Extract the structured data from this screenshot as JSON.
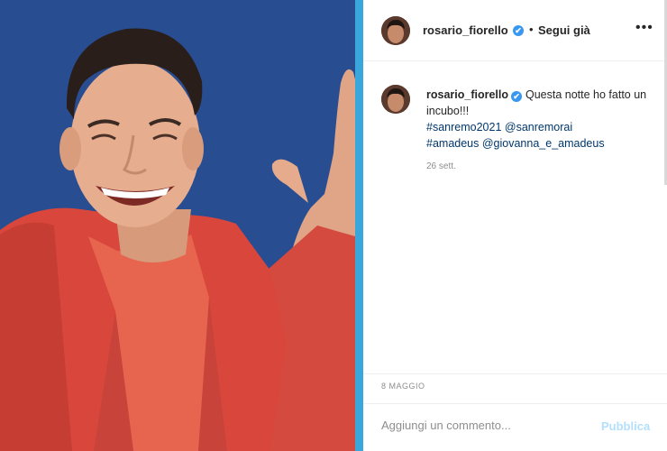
{
  "post": {
    "username": "rosario_fiorello",
    "follow_status": "Segui già",
    "follow_separator": "•",
    "verified_glyph": "✔",
    "more_glyph": "•••",
    "caption": {
      "username": "rosario_fiorello",
      "text": "Questa notte ho fatto un incubo!!!",
      "hashtag_1": "#sanremo2021",
      "mention_1": "@sanremorai",
      "hashtag_2": "#amadeus",
      "mention_2": "@giovanna_e_amadeus",
      "time_ago": "26 sett."
    },
    "date": "8 MAGGIO"
  },
  "comment": {
    "placeholder": "Aggiungi un commento...",
    "publish_label": "Pubblica"
  },
  "colors": {
    "accent_blue": "#3aa7dc",
    "verified": "#3897f0",
    "publish_disabled": "#b2dffc",
    "link": "#00376b",
    "jacket": "#d9473c"
  },
  "icons": [
    "avatar",
    "verified-icon",
    "more-options-icon"
  ]
}
